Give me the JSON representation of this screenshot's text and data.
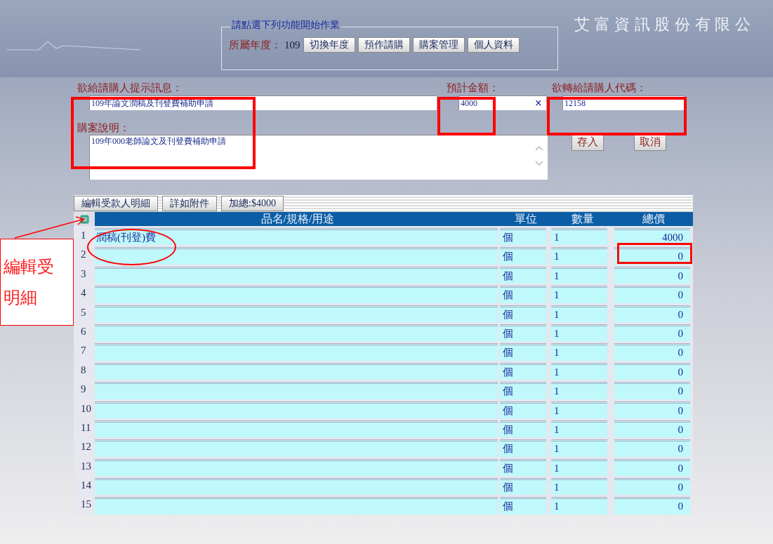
{
  "background": {
    "company": "艾 富 資 訊 股 份 有 限 公"
  },
  "header": {
    "legend": "請點選下列功能開始作業",
    "year_label": "所屬年度：",
    "year": "109",
    "buttons": [
      "切換年度",
      "預作請購",
      "購案管理",
      "個人資料"
    ]
  },
  "form": {
    "message_label": "欲給請購人提示訊息：",
    "message": "109年論文潤稿及刊登費補助申請",
    "amount_label": "預計金額：",
    "amount": "4000",
    "clear": "×",
    "transfer_label": "欲轉給請購人代碼：",
    "transfer_code": "12158",
    "description_label": "購案說明：",
    "description": "109年000老師論文及刊登費補助申請",
    "buttons": [
      "存入",
      "取消"
    ]
  },
  "table": {
    "toolbar": [
      "編輯受款人明細",
      "詳如附件",
      "加總:$4000"
    ],
    "columns": [
      "品名/規格/用途",
      "單位",
      "數量",
      "總價"
    ],
    "rows": [
      {
        "no": "1",
        "name": "潤稿(刊登)費",
        "unit": "個",
        "qty": "1",
        "total": "4000"
      },
      {
        "no": "2",
        "unit": "個",
        "qty": "1",
        "total": "0"
      },
      {
        "no": "3",
        "unit": "個",
        "qty": "1",
        "total": "0"
      },
      {
        "no": "4",
        "unit": "個",
        "qty": "1",
        "total": "0"
      },
      {
        "no": "5",
        "unit": "個",
        "qty": "1",
        "total": "0"
      },
      {
        "no": "6",
        "unit": "個",
        "qty": "1",
        "total": "0"
      },
      {
        "no": "7",
        "unit": "個",
        "qty": "1",
        "total": "0"
      },
      {
        "no": "8",
        "unit": "個",
        "qty": "1",
        "total": "0"
      },
      {
        "no": "9",
        "unit": "個",
        "qty": "1",
        "total": "0"
      },
      {
        "no": "10",
        "unit": "個",
        "qty": "1",
        "total": "0"
      },
      {
        "no": "11",
        "unit": "個",
        "qty": "1",
        "total": "0"
      },
      {
        "no": "12",
        "unit": "個",
        "qty": "1",
        "total": "0"
      },
      {
        "no": "13",
        "unit": "個",
        "qty": "1",
        "total": "0"
      },
      {
        "no": "14",
        "unit": "個",
        "qty": "1",
        "total": "0"
      },
      {
        "no": "15",
        "unit": "個",
        "qty": "1",
        "total": "0"
      }
    ]
  },
  "annotation": {
    "callout": [
      "編輯受",
      "明細"
    ]
  }
}
